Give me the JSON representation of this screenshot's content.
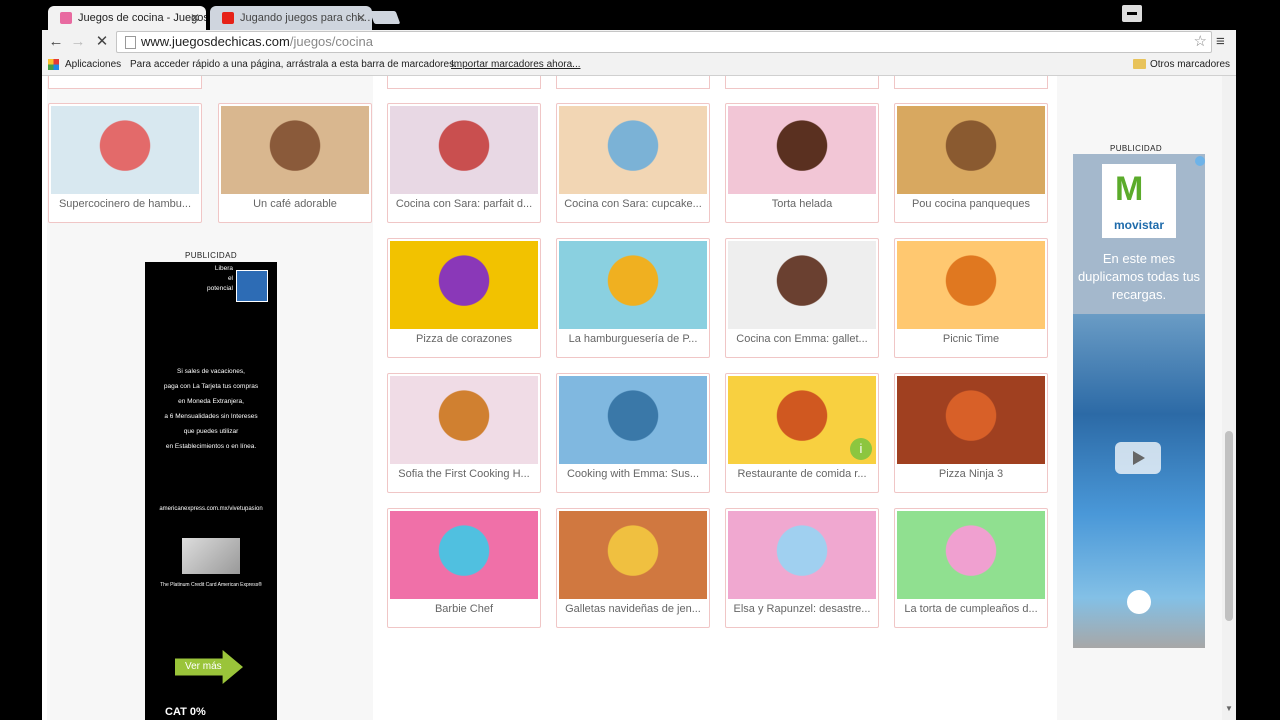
{
  "browser": {
    "tabs": [
      {
        "title": "Juegos de cocina - Juegos",
        "active": true
      },
      {
        "title": "Jugando juegos para chi…",
        "active": false
      }
    ],
    "url_domain": "www.juegosdechicas.com",
    "url_path": "/juegos/cocina",
    "bookmarks": {
      "apps": "Aplicaciones",
      "hint": "Para acceder rápido a una página, arrástrala a esta barra de marcadores.",
      "import": "Importar marcadores ahora...",
      "other": "Otros marcadores"
    }
  },
  "games": [
    {
      "title": "Supercocinero de hambu...",
      "colors": [
        "#d8e8f0",
        "#e36a6a"
      ]
    },
    {
      "title": "Un café adorable",
      "colors": [
        "#d9b78f",
        "#8a5a3a"
      ]
    },
    {
      "title": "Cocina con Sara: parfait d...",
      "colors": [
        "#e8d8e4",
        "#c94f4f"
      ]
    },
    {
      "title": "Cocina con Sara: cupcake...",
      "colors": [
        "#f2d6b4",
        "#7bb2d6"
      ]
    },
    {
      "title": "Torta helada",
      "colors": [
        "#f2c6d6",
        "#5a3020"
      ]
    },
    {
      "title": "Pou cocina panqueques",
      "colors": [
        "#d8a860",
        "#8a5a30"
      ]
    },
    {
      "title": "Pizza de corazones",
      "colors": [
        "#f2c200",
        "#8a38b8"
      ]
    },
    {
      "title": "La hamburguesería de P...",
      "colors": [
        "#8ad0e0",
        "#f0b020"
      ]
    },
    {
      "title": "Cocina con Emma: gallet...",
      "colors": [
        "#eeeeee",
        "#6a4030"
      ]
    },
    {
      "title": "Picnic Time",
      "colors": [
        "#ffc870",
        "#e07820"
      ]
    },
    {
      "title": "Sofia the First Cooking H...",
      "colors": [
        "#f0dce6",
        "#d08030"
      ]
    },
    {
      "title": "Cooking with Emma: Sus...",
      "colors": [
        "#80b8e0",
        "#3a78a8"
      ]
    },
    {
      "title": "Restaurante de comida r...",
      "colors": [
        "#f8d040",
        "#d05820"
      ]
    },
    {
      "title": "Pizza Ninja 3",
      "colors": [
        "#a04020",
        "#d86028"
      ]
    },
    {
      "title": "Barbie Chef",
      "colors": [
        "#f070a8",
        "#50c0e0"
      ]
    },
    {
      "title": "Galletas navideñas de jen...",
      "colors": [
        "#d07840",
        "#f0c040"
      ]
    },
    {
      "title": "Elsa y Rapunzel: desastre...",
      "colors": [
        "#f0a8d0",
        "#a0d0f0"
      ]
    },
    {
      "title": "La torta de cumpleaños d...",
      "colors": [
        "#90e090",
        "#f0a0d0"
      ]
    }
  ],
  "ads": {
    "label": "PUBLICIDAD",
    "amex": {
      "tagline_1": "Libera",
      "tagline_2": "el",
      "tagline_3": "potencial",
      "line1": "Si sales de vacaciones,",
      "line2": "paga con La Tarjeta tus compras",
      "line3": "en Moneda Extranjera,",
      "line4": "a 6 Mensualidades sin Intereses",
      "line5": "que puedes utilizar",
      "line6": "en Establecimientos o en línea.",
      "url": "americanexpress.com.mx/vivetupasion",
      "card_caption": "The Platinum Credit Card American Express®",
      "cta": "Ver más",
      "cat": "CAT 0%"
    },
    "movistar": {
      "brand": "movistar",
      "text": "En este mes duplicamos todas tus recargas."
    }
  },
  "colors": {
    "card_border": "#f0c6c6",
    "title_text": "#666666",
    "accent_green": "#8cc63f"
  }
}
